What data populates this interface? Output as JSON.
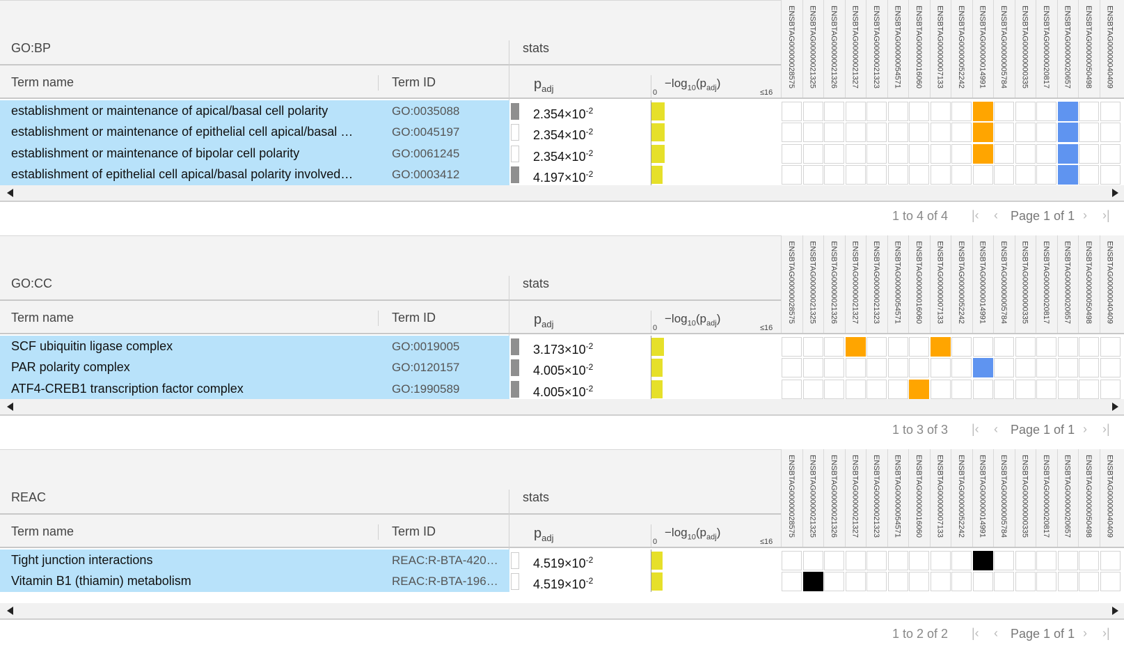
{
  "gene_ids": [
    "ENSBTAG00000028575",
    "ENSBTAG00000021325",
    "ENSBTAG00000021326",
    "ENSBTAG00000021327",
    "ENSBTAG00000021323",
    "ENSBTAG00000054571",
    "ENSBTAG00000016060",
    "ENSBTAG00000007133",
    "ENSBTAG00000052242",
    "ENSBTAG00000014991",
    "ENSBTAG00000005784",
    "ENSBTAG00000000335",
    "ENSBTAG00000020817",
    "ENSBTAG00000020657",
    "ENSBTAG00000050498",
    "ENSBTAG00000040409"
  ],
  "colors": {
    "orange": "#ffa500",
    "blue": "#5f94f0",
    "black": "#000000",
    "highlight": "#b8e2fa",
    "bar": "#e6e02a"
  },
  "column_labels": {
    "term_name": "Term name",
    "term_id": "Term ID",
    "stats": "stats",
    "padj": "p",
    "padj_sub": "adj",
    "log_prefix": "−log",
    "log_sub": "10",
    "log_open": "(p",
    "log_inner_sub": "adj",
    "log_close": ")",
    "tick_min": "0",
    "tick_max": "≤16"
  },
  "pager_nav": {
    "first": "|‹",
    "prev": "‹",
    "next": "›",
    "last": "›|"
  },
  "panels": [
    {
      "source": "GO:BP",
      "rows": [
        {
          "name": "establishment or maintenance of apical/basal cell polarity",
          "id": "GO:0035088",
          "mark": "filled",
          "padj_mant": "2.354×10",
          "padj_exp": "-2",
          "neglog": 1.628,
          "hits": [
            {
              "col": 9,
              "color": "orange"
            },
            {
              "col": 13,
              "color": "blue"
            }
          ]
        },
        {
          "name": "establishment or maintenance of epithelial cell apical/basal …",
          "id": "GO:0045197",
          "mark": "empty",
          "padj_mant": "2.354×10",
          "padj_exp": "-2",
          "neglog": 1.628,
          "hits": [
            {
              "col": 9,
              "color": "orange"
            },
            {
              "col": 13,
              "color": "blue"
            }
          ]
        },
        {
          "name": "establishment or maintenance of bipolar cell polarity",
          "id": "GO:0061245",
          "mark": "empty",
          "padj_mant": "2.354×10",
          "padj_exp": "-2",
          "neglog": 1.628,
          "hits": [
            {
              "col": 9,
              "color": "orange"
            },
            {
              "col": 13,
              "color": "blue"
            }
          ]
        },
        {
          "name": "establishment of epithelial cell apical/basal polarity involved…",
          "id": "GO:0003412",
          "mark": "filled",
          "padj_mant": "4.197×10",
          "padj_exp": "-2",
          "neglog": 1.377,
          "hits": [
            {
              "col": 13,
              "color": "blue"
            }
          ]
        }
      ],
      "pager": {
        "count": "1 to 4 of 4",
        "page": "Page 1 of 1"
      }
    },
    {
      "source": "GO:CC",
      "rows": [
        {
          "name": "SCF ubiquitin ligase complex",
          "id": "GO:0019005",
          "mark": "filled",
          "padj_mant": "3.173×10",
          "padj_exp": "-2",
          "neglog": 1.499,
          "hits": [
            {
              "col": 3,
              "color": "orange"
            },
            {
              "col": 7,
              "color": "orange"
            }
          ]
        },
        {
          "name": "PAR polarity complex",
          "id": "GO:0120157",
          "mark": "filled",
          "padj_mant": "4.005×10",
          "padj_exp": "-2",
          "neglog": 1.397,
          "hits": [
            {
              "col": 9,
              "color": "blue"
            }
          ]
        },
        {
          "name": "ATF4-CREB1 transcription factor complex",
          "id": "GO:1990589",
          "mark": "filled",
          "padj_mant": "4.005×10",
          "padj_exp": "-2",
          "neglog": 1.397,
          "hits": [
            {
              "col": 6,
              "color": "orange"
            }
          ]
        }
      ],
      "pager": {
        "count": "1 to 3 of 3",
        "page": "Page 1 of 1"
      }
    },
    {
      "source": "REAC",
      "rows": [
        {
          "name": "Tight junction interactions",
          "id": "REAC:R-BTA-420…",
          "mark": "empty",
          "padj_mant": "4.519×10",
          "padj_exp": "-2",
          "neglog": 1.345,
          "hits": [
            {
              "col": 9,
              "color": "black"
            }
          ]
        },
        {
          "name": "Vitamin B1 (thiamin) metabolism",
          "id": "REAC:R-BTA-196…",
          "mark": "empty",
          "padj_mant": "4.519×10",
          "padj_exp": "-2",
          "neglog": 1.345,
          "hits": [
            {
              "col": 1,
              "color": "black"
            }
          ]
        }
      ],
      "pager": {
        "count": "1 to 2 of 2",
        "page": "Page 1 of 1"
      }
    }
  ]
}
